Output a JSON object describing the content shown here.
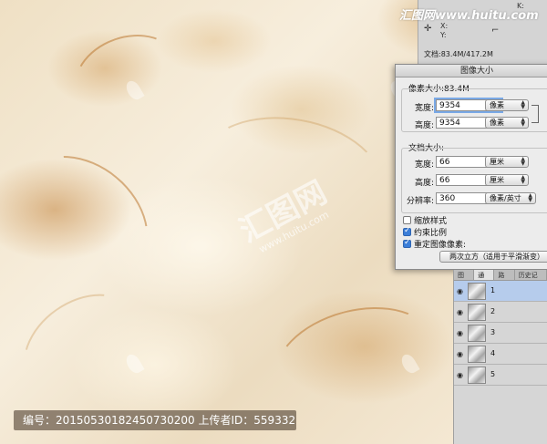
{
  "site_logo": "汇图网www.huitu.com",
  "watermark": {
    "center_text": "汇图网",
    "center_sub": "www.huitu.com"
  },
  "info_panel": {
    "xy_label_x": "X:",
    "xy_label_y": "Y:",
    "k_label": "K:",
    "doc_size": "文档:83.4M/417.2M"
  },
  "dialog": {
    "title": "图像大小",
    "pixel_dimensions_label": "像素大小:83.4M",
    "pixel_width_label": "宽度:",
    "pixel_width_value": "9354",
    "pixel_width_unit": "像素",
    "pixel_height_label": "高度:",
    "pixel_height_value": "9354",
    "pixel_height_unit": "像素",
    "doc_size_label": "文档大小:",
    "doc_width_label": "宽度:",
    "doc_width_value": "66",
    "doc_width_unit": "厘米",
    "doc_height_label": "高度:",
    "doc_height_value": "66",
    "doc_height_unit": "厘米",
    "resolution_label": "分辨率:",
    "resolution_value": "360",
    "resolution_unit": "像素/英寸",
    "scale_styles_label": "缩放样式",
    "scale_styles_checked": false,
    "constrain_label": "约束比例",
    "constrain_checked": true,
    "resample_label": "重定图像像素:",
    "resample_checked": true,
    "resample_method": "两次立方（适用于平滑渐变）"
  },
  "channels_panel": {
    "tabs": [
      "图层",
      "通道",
      "路径",
      "历史记录"
    ],
    "active_tab": "通道",
    "rows": [
      {
        "name": "1",
        "selected": true
      },
      {
        "name": "2",
        "selected": false
      },
      {
        "name": "3",
        "selected": false
      },
      {
        "name": "4",
        "selected": false
      },
      {
        "name": "5",
        "selected": false
      }
    ]
  },
  "caption": "编号：20150530182450730200 上传者ID：559332",
  "colors": {
    "accent_blue": "#3b7ed8",
    "selected_row": "#b6ccec"
  }
}
